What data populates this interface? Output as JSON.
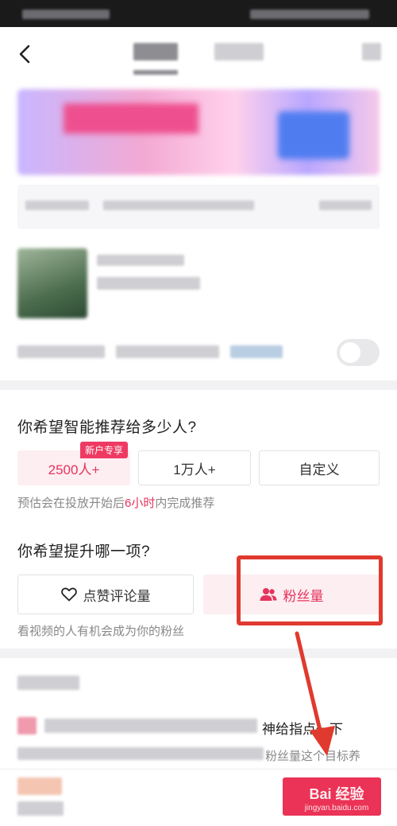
{
  "colors": {
    "accent": "#e5345d",
    "badge": "#ee3a62",
    "selected_bg": "#fdeef1",
    "annotation_red": "#e03a2f",
    "page_bg": "#f2f2f4"
  },
  "nav": {
    "back_icon": "chevron-left-icon"
  },
  "reach": {
    "title": "你希望智能推荐给多少人?",
    "options": [
      {
        "label": "2500人+",
        "badge": "新户专享",
        "selected": true
      },
      {
        "label": "1万人+",
        "selected": false
      },
      {
        "label": "自定义",
        "selected": false
      }
    ],
    "hint_prefix": "预估会在投放开始后",
    "hint_highlight": "6小时",
    "hint_suffix": "内完成推荐"
  },
  "goal": {
    "title": "你希望提升哪一项?",
    "options": [
      {
        "label": "点赞评论量",
        "icon": "heart-icon",
        "selected": false
      },
      {
        "label": "粉丝量",
        "icon": "users-icon",
        "selected": true
      }
    ],
    "hint": "看视频的人有机会成为你的粉丝"
  },
  "bottom": {
    "partial_line1": "神给指点一下",
    "partial_line2": "粉丝量这个目标养"
  },
  "watermark": {
    "main": "Bai 经验",
    "sub": "jingyan.baidu.com"
  }
}
